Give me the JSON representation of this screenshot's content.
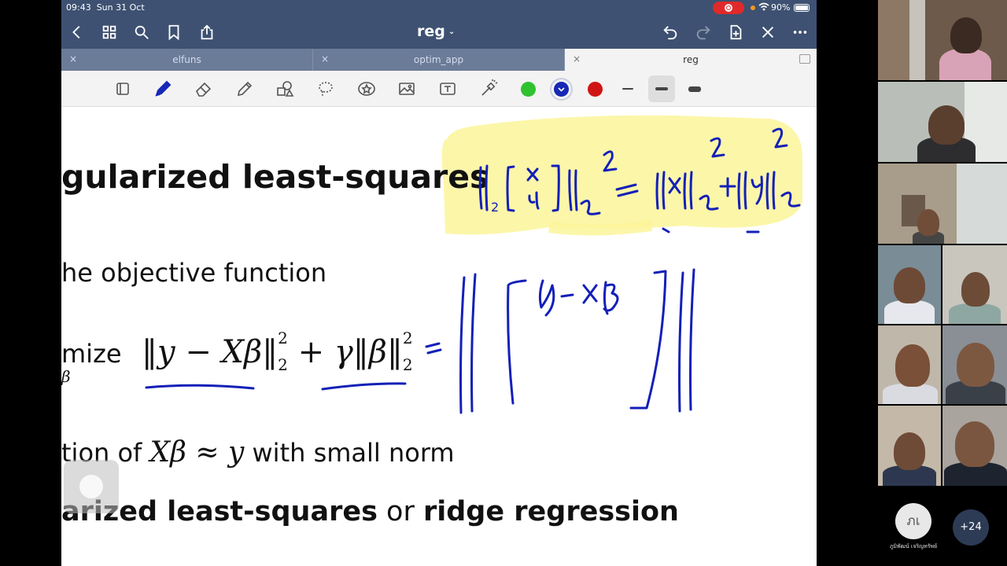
{
  "status": {
    "time": "09:43",
    "date": "Sun 31 Oct",
    "battery": "90%"
  },
  "navbar": {
    "title": "reg",
    "title_chevron": "⌄"
  },
  "tabs": [
    {
      "label": "elfuns",
      "close": "×"
    },
    {
      "label": "optim_app",
      "close": "×"
    },
    {
      "label": "reg",
      "close": "×"
    }
  ],
  "toolbar": {
    "tools": [
      "page-layout-icon",
      "pen-icon",
      "eraser-icon",
      "pencil-icon",
      "shapes-icon",
      "lasso-icon",
      "sticker-icon",
      "image-icon",
      "text-icon",
      "laser-icon"
    ],
    "colors": [
      "#2fc22f",
      "#1728b5",
      "#d01515"
    ],
    "selected_color": "#1728b5",
    "stroke_weights": [
      "thin",
      "medium",
      "thick"
    ],
    "selected_weight": "medium"
  },
  "document": {
    "heading1": "gularized least-squares",
    "line_objective": "he objective function",
    "minimize_word": "mize",
    "minimize_sub": "β",
    "formula": {
      "a": "‖y − Xβ‖",
      "sub": "2",
      "sup": "2",
      "plus": " + ",
      "g": "γ‖β‖",
      "eq": "="
    },
    "line_approx_a": "tion of ",
    "line_approx_math": "Xβ ≈ y",
    "line_approx_b": " with small norm",
    "heading2_a": "arized least-squares",
    "heading2_or": " or ",
    "heading2_b": "ridge regression"
  },
  "annotations": {
    "ink_color": "#1320b8",
    "highlight_color": "#fbf49a",
    "hw_y": "y",
    "hw_minus_xb": "−Xβ"
  },
  "participants": {
    "user_initials": "ภเ",
    "user_name": "ภูมิพัฒน์ เจริญทรัพย์",
    "more_count": "+24"
  }
}
